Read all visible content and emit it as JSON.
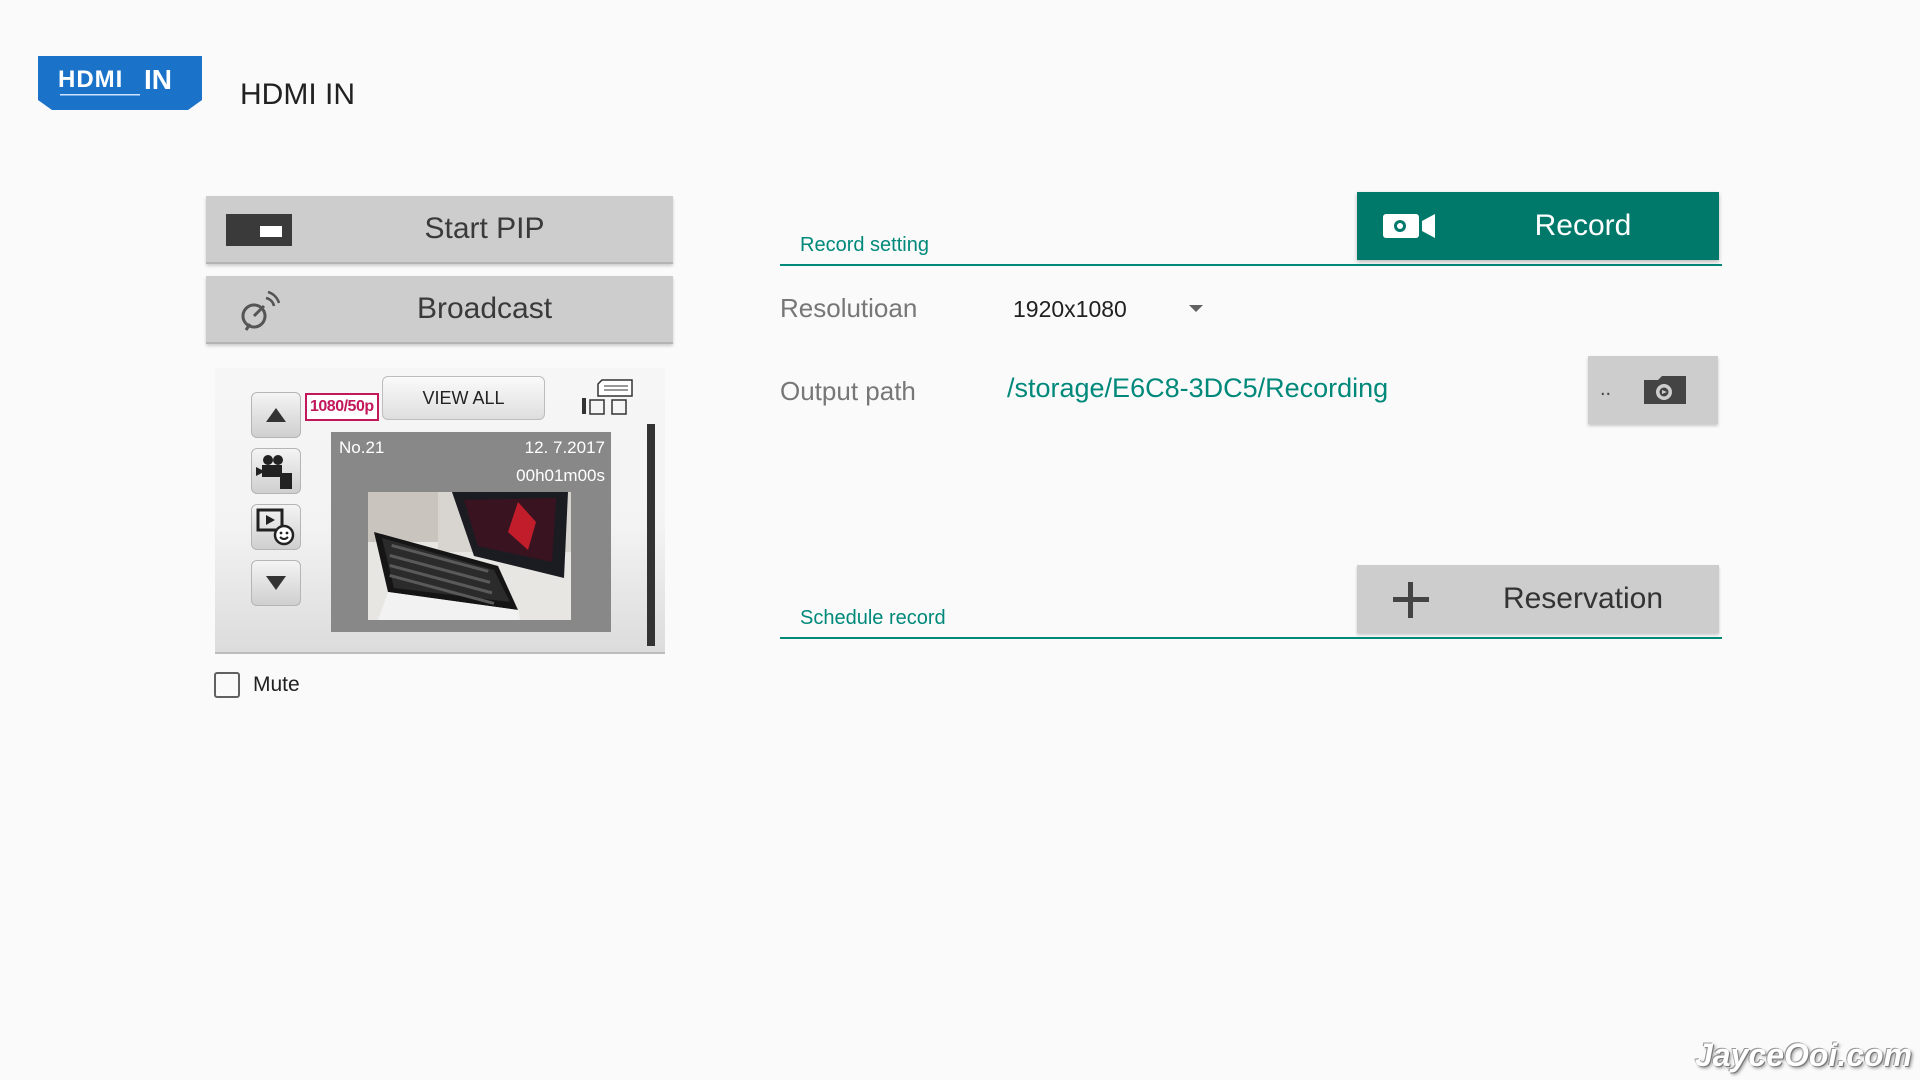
{
  "header": {
    "logo_text": "HDMI IN",
    "title": "HDMI IN"
  },
  "left_panel": {
    "start_pip_label": "Start PIP",
    "broadcast_label": "Broadcast",
    "preview": {
      "resolution_badge": "1080/50p",
      "view_all_label": "VIEW ALL",
      "clip_number": "No.21",
      "clip_date": "12. 7.2017",
      "clip_duration": "00h01m00s"
    },
    "mute_label": "Mute",
    "mute_checked": false
  },
  "record_setting": {
    "section_title": "Record setting",
    "record_label": "Record",
    "resolution_label": "Resolutioan",
    "resolution_value": "1920x1080",
    "output_path_label": "Output path",
    "output_path_value": "/storage/E6C8-3DC5/Recording",
    "browse_label": ".."
  },
  "schedule": {
    "section_title": "Schedule record",
    "reservation_label": "Reservation"
  },
  "watermark": "JayceOoi.com",
  "colors": {
    "accent": "#00897b",
    "record_button": "#00796b",
    "button_gray": "#cdcdcd",
    "logo_blue": "#1a73c8"
  }
}
